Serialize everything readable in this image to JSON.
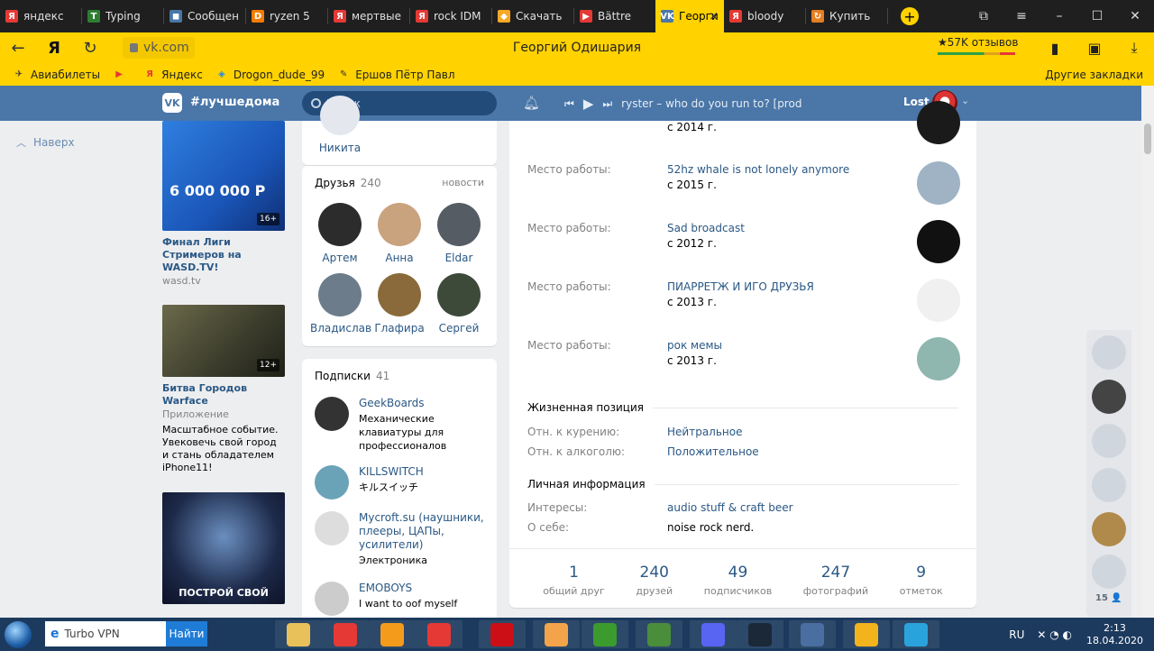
{
  "browser": {
    "tabs": [
      {
        "title": "яндекс",
        "fav_color": "#e53935",
        "fav_glyph": "Я"
      },
      {
        "title": "Typing",
        "fav_color": "#2e7d32",
        "fav_glyph": "T"
      },
      {
        "title": "Сообщения",
        "fav_color": "#4a76a8",
        "fav_glyph": "◼"
      },
      {
        "title": "ryzen 5",
        "fav_color": "#f57c00",
        "fav_glyph": "D"
      },
      {
        "title": "мертвые",
        "fav_color": "#e53935",
        "fav_glyph": "Я"
      },
      {
        "title": "rock IDM",
        "fav_color": "#e53935",
        "fav_glyph": "Я"
      },
      {
        "title": "Скачать",
        "fav_color": "#f9a825",
        "fav_glyph": "◆"
      },
      {
        "title": "Bättre",
        "fav_color": "#e53935",
        "fav_glyph": "▶"
      },
      {
        "title": "Георгий",
        "fav_color": "#4a76a8",
        "fav_glyph": "VK",
        "active": true
      },
      {
        "title": "bloody",
        "fav_color": "#e53935",
        "fav_glyph": "Я"
      },
      {
        "title": "Купить",
        "fav_color": "#e67e22",
        "fav_glyph": "↻"
      }
    ],
    "url": "vk.com",
    "page_title": "Георгий Одишария",
    "reviews": "★57K отзывов",
    "bookmarks": [
      {
        "label": "Авиабилеты",
        "color": "#ffffff",
        "glyph": "✈"
      },
      {
        "label": "",
        "color": "#e53935",
        "glyph": "▶"
      },
      {
        "label": "Яндекс",
        "color": "#e53935",
        "glyph": "Я"
      },
      {
        "label": "Drogon_dude_99",
        "color": "#1e88e5",
        "glyph": "◈"
      },
      {
        "label": "Ершов Пётр Павл",
        "color": "#333333",
        "glyph": "✎"
      }
    ],
    "other_bookmarks": "Другие закладки"
  },
  "vk": {
    "logo": "VK",
    "hashtag": "#лучшедома",
    "search_placeholder": "Поиск",
    "track": "ryster – who do you run to? [prod. si...",
    "user": "Lost"
  },
  "left_nav": {
    "up": "Наверх"
  },
  "ads": [
    {
      "title": "Финал Лиги Стримеров на WASD.TV!",
      "sub": "wasd.tv",
      "text": "",
      "badge": "16+",
      "img_text": "6 000 000 Р"
    },
    {
      "title": "Битва Городов Warface",
      "sub": "Приложение",
      "text": "Масштабное событие. Увековечь свой город и стань обладателем iPhone11!",
      "badge": "12+"
    },
    {
      "title": "",
      "sub": "",
      "text": "",
      "badge": "",
      "img_text": "ПОСТРОЙ СВОЙ"
    }
  ],
  "nikita": {
    "name": "Никита"
  },
  "friends": {
    "title": "Друзья",
    "count": "240",
    "link": "новости",
    "items": [
      {
        "name": "Артем",
        "color": "#2c2c2c"
      },
      {
        "name": "Анна",
        "color": "#c9a27e"
      },
      {
        "name": "Eldar",
        "color": "#555c63"
      },
      {
        "name": "Владислав",
        "color": "#6d7c8a"
      },
      {
        "name": "Глафира",
        "color": "#8a6a3a"
      },
      {
        "name": "Сергей",
        "color": "#3d4a3a"
      }
    ]
  },
  "subs": {
    "title": "Подписки",
    "count": "41",
    "items": [
      {
        "name": "GeekBoards",
        "desc": "Механические клавиатуры для профессионалов",
        "color": "#333333"
      },
      {
        "name": "KILLSWITCH",
        "desc": "キルスイッチ",
        "color": "#6aa3b8"
      },
      {
        "name": "Mycroft.su (наушники, плееры, ЦАПы, усилители)",
        "desc": "Электроника",
        "color": "#dddddd"
      },
      {
        "name": "EMOBOYS",
        "desc": "I want to oof myself",
        "color": "#cccccc"
      }
    ]
  },
  "profile": {
    "work_top_year": "с 2014 г.",
    "work": [
      {
        "label": "Место работы:",
        "name": "52hz whale is not lonely anymore",
        "years": "с 2015 г.",
        "color": "#9fb3c5"
      },
      {
        "label": "Место работы:",
        "name": "Sad broadcast",
        "years": "с 2012 г.",
        "color": "#111111"
      },
      {
        "label": "Место работы:",
        "name": "ПИАРРЕТЖ И ИГО ДРУЗЬЯ",
        "years": "с 2013 г.",
        "color": "#f0f0f0"
      },
      {
        "label": "Место работы:",
        "name": "рок мемы",
        "years": "с 2013 г.",
        "color": "#8fb7b0"
      }
    ],
    "life_title": "Жизненная позиция",
    "life": [
      {
        "label": "Отн. к курению:",
        "value": "Нейтральное"
      },
      {
        "label": "Отн. к алкоголю:",
        "value": "Положительное"
      }
    ],
    "personal_title": "Личная информация",
    "personal": [
      {
        "label": "Интересы:",
        "value": "audio stuff & craft beer"
      },
      {
        "label": "О себе:",
        "value": "noise rock nerd."
      }
    ],
    "counters": [
      {
        "n": "1",
        "t": "общий друг"
      },
      {
        "n": "240",
        "t": "друзей"
      },
      {
        "n": "49",
        "t": "подписчиков"
      },
      {
        "n": "247",
        "t": "фотографий"
      },
      {
        "n": "9",
        "t": "отметок"
      }
    ]
  },
  "dock": {
    "count": "15 👤"
  },
  "taskbar": {
    "search_text": "Turbo VPN",
    "find_button": "Найти",
    "lang": "RU",
    "time": "2:13",
    "date": "18.04.2020"
  }
}
